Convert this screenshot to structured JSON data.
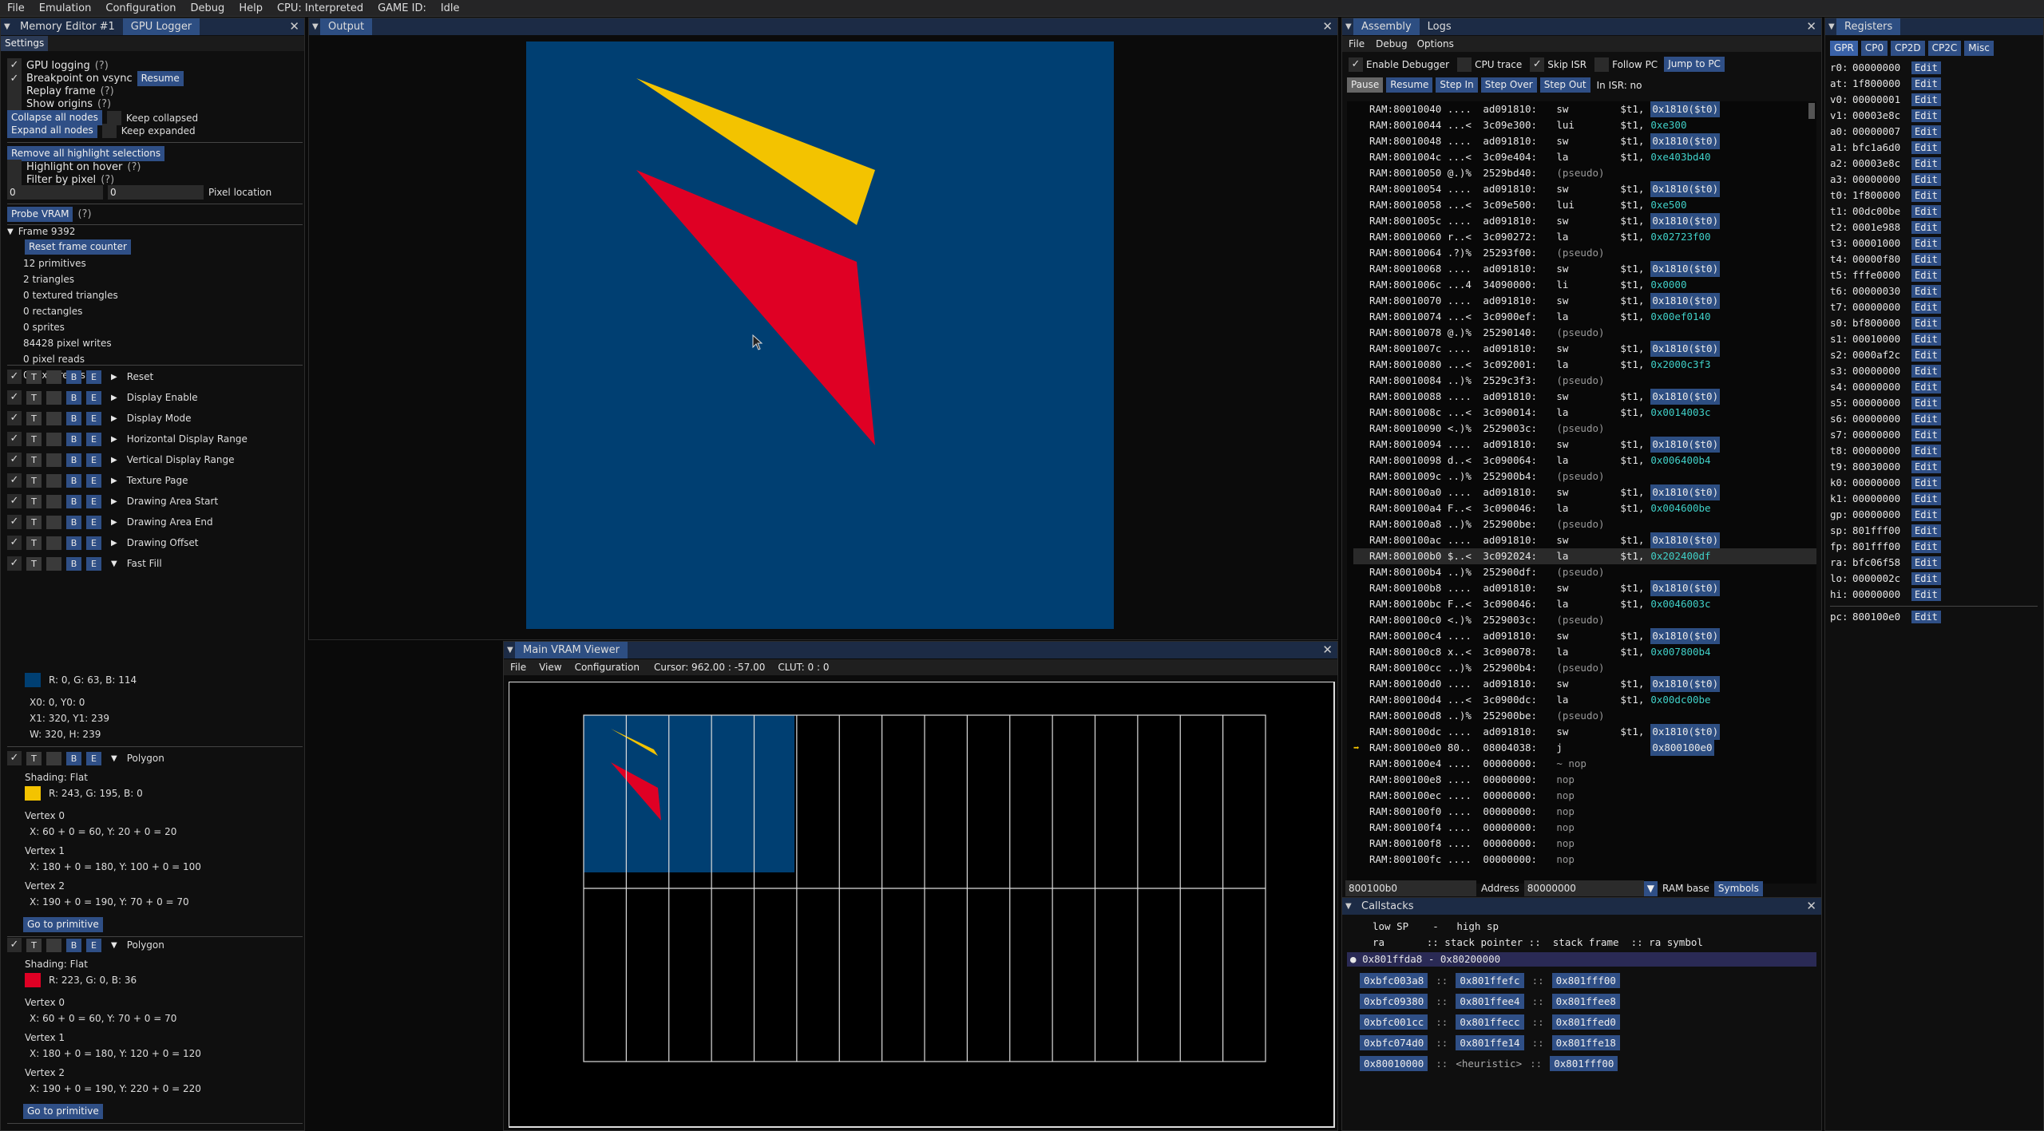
{
  "menubar": {
    "items": [
      "File",
      "Emulation",
      "Configuration",
      "Debug",
      "Help",
      "CPU: Interpreted",
      "GAME ID:",
      "Idle"
    ]
  },
  "left_panel": {
    "tabs": [
      "Memory Editor #1",
      "GPU Logger"
    ],
    "settings_tab": "Settings",
    "gpu_logging": "GPU logging",
    "hint": "(?)",
    "breakpoint_on_vsync": "Breakpoint on vsync",
    "resume": "Resume",
    "replay_frame": "Replay frame",
    "show_origins": "Show origins",
    "collapse_all": "Collapse all nodes",
    "keep_collapsed": "Keep collapsed",
    "expand_all": "Expand all nodes",
    "keep_expanded": "Keep expanded",
    "remove_highlights": "Remove all highlight selections",
    "highlight_on_hover": "Highlight on hover",
    "filter_by_pixel": "Filter by pixel",
    "pixel_x": "0",
    "pixel_y": "0",
    "pixel_location": "Pixel location",
    "probe_vram": "Probe VRAM",
    "frame": "Frame 9392",
    "reset_frame_counter": "Reset frame counter",
    "stats": [
      "12 primitives",
      "2 triangles",
      "0 textured triangles",
      "0 rectangles",
      "0 sprites",
      "84428 pixel writes",
      "0 pixel reads",
      "0 texel reads"
    ],
    "commands": [
      "Reset",
      "Display Enable",
      "Display Mode",
      "Horizontal Display Range",
      "Vertical Display Range",
      "Texture Page",
      "Drawing Area Start",
      "Drawing Area End",
      "Drawing Offset",
      "Fast Fill"
    ],
    "fastfill": {
      "color": "#003f72",
      "color_text": "R: 0, G: 63, B: 114",
      "pos": "X0: 0, Y0: 0",
      "x1y1": "X1: 320, Y1: 239",
      "wh": "W: 320, H: 239"
    },
    "polygon_label": "Polygon",
    "poly1": {
      "shading": "Shading: Flat",
      "color": "#f3c300",
      "color_text": "R: 243, G: 195, B: 0",
      "v0": "Vertex 0",
      "v0v": "X: 60 + 0 = 60, Y: 20 + 0 = 20",
      "v1": "Vertex 1",
      "v1v": "X: 180 + 0 = 180, Y: 100 + 0 = 100",
      "v2": "Vertex 2",
      "v2v": "X: 190 + 0 = 190, Y: 70 + 0 = 70"
    },
    "poly2": {
      "shading": "Shading: Flat",
      "color": "#df0024",
      "color_text": "R: 223, G: 0, B: 36",
      "v0": "Vertex 0",
      "v0v": "X: 60 + 0 = 60, Y: 70 + 0 = 70",
      "v1": "Vertex 1",
      "v1v": "X: 180 + 0 = 180, Y: 120 + 0 = 120",
      "v2": "Vertex 2",
      "v2v": "X: 190 + 0 = 190, Y: 220 + 0 = 220"
    },
    "goto": "Go to primitive",
    "tog_t": "T",
    "tog_b": "B",
    "tog_e": "E"
  },
  "output": {
    "title": "Output",
    "bg": "#003f72"
  },
  "vram": {
    "title": "Main VRAM Viewer",
    "menu": [
      "File",
      "View",
      "Configuration"
    ],
    "cursor": "Cursor: 962.00 : -57.00",
    "clut": "CLUT: 0 : 0"
  },
  "assembly": {
    "tabs": [
      "Assembly",
      "Logs"
    ],
    "menu": [
      "File",
      "Debug",
      "Options"
    ],
    "enable_debugger": "Enable Debugger",
    "cpu_trace": "CPU trace",
    "skip_isr": "Skip ISR",
    "follow_pc": "Follow PC",
    "jump_to_pc": "Jump to PC",
    "pause": "Pause",
    "resume": "Resume",
    "step_in": "Step In",
    "step_over": "Step Over",
    "step_out": "Step Out",
    "in_isr": "In ISR: no",
    "lines": [
      {
        "a": "RAM:80010040",
        "b": " ....",
        "c": "ad091810:",
        "d": "sw",
        "e": "$t1,",
        "f": "0x1810($t0)",
        "t": "hl"
      },
      {
        "a": "RAM:80010044",
        "b": " ...<",
        "c": "3c09e300:",
        "d": "lui",
        "e": "$t1,",
        "f": "0xe300",
        "t": "teal"
      },
      {
        "a": "RAM:80010048",
        "b": " ....",
        "c": "ad091810:",
        "d": "sw",
        "e": "$t1,",
        "f": "0x1810($t0)",
        "t": "hl"
      },
      {
        "a": "RAM:8001004c",
        "b": " ...<",
        "c": "3c09e404:",
        "d": "la",
        "e": "$t1,",
        "f": "0xe403bd40",
        "t": "teal"
      },
      {
        "a": "RAM:80010050",
        "b": " @.)%",
        "c": "2529bd40:",
        "d": "(pseudo)",
        "e": "",
        "f": "",
        "t": "p"
      },
      {
        "a": "RAM:80010054",
        "b": " ....",
        "c": "ad091810:",
        "d": "sw",
        "e": "$t1,",
        "f": "0x1810($t0)",
        "t": "hl"
      },
      {
        "a": "RAM:80010058",
        "b": " ...<",
        "c": "3c09e500:",
        "d": "lui",
        "e": "$t1,",
        "f": "0xe500",
        "t": "teal"
      },
      {
        "a": "RAM:8001005c",
        "b": " ....",
        "c": "ad091810:",
        "d": "sw",
        "e": "$t1,",
        "f": "0x1810($t0)",
        "t": "hl"
      },
      {
        "a": "RAM:80010060",
        "b": " r..<",
        "c": "3c090272:",
        "d": "la",
        "e": "$t1,",
        "f": "0x02723f00",
        "t": "teal"
      },
      {
        "a": "RAM:80010064",
        "b": " .?)%",
        "c": "25293f00:",
        "d": "(pseudo)",
        "e": "",
        "f": "",
        "t": "p"
      },
      {
        "a": "RAM:80010068",
        "b": " ....",
        "c": "ad091810:",
        "d": "sw",
        "e": "$t1,",
        "f": "0x1810($t0)",
        "t": "hl"
      },
      {
        "a": "RAM:8001006c",
        "b": " ...4",
        "c": "34090000:",
        "d": "li",
        "e": "$t1,",
        "f": "0x0000",
        "t": "teal"
      },
      {
        "a": "RAM:80010070",
        "b": " ....",
        "c": "ad091810:",
        "d": "sw",
        "e": "$t1,",
        "f": "0x1810($t0)",
        "t": "hl"
      },
      {
        "a": "RAM:80010074",
        "b": " ...<",
        "c": "3c0900ef:",
        "d": "la",
        "e": "$t1,",
        "f": "0x00ef0140",
        "t": "teal"
      },
      {
        "a": "RAM:80010078",
        "b": " @.)%",
        "c": "25290140:",
        "d": "(pseudo)",
        "e": "",
        "f": "",
        "t": "p"
      },
      {
        "a": "RAM:8001007c",
        "b": " ....",
        "c": "ad091810:",
        "d": "sw",
        "e": "$t1,",
        "f": "0x1810($t0)",
        "t": "hl"
      },
      {
        "a": "RAM:80010080",
        "b": " ...<",
        "c": "3c092001:",
        "d": "la",
        "e": "$t1,",
        "f": "0x2000c3f3",
        "t": "teal"
      },
      {
        "a": "RAM:80010084",
        "b": " ..)%",
        "c": "2529c3f3:",
        "d": "(pseudo)",
        "e": "",
        "f": "",
        "t": "p"
      },
      {
        "a": "RAM:80010088",
        "b": " ....",
        "c": "ad091810:",
        "d": "sw",
        "e": "$t1,",
        "f": "0x1810($t0)",
        "t": "hl"
      },
      {
        "a": "RAM:8001008c",
        "b": " ...<",
        "c": "3c090014:",
        "d": "la",
        "e": "$t1,",
        "f": "0x0014003c",
        "t": "teal"
      },
      {
        "a": "RAM:80010090",
        "b": " <.)%",
        "c": "2529003c:",
        "d": "(pseudo)",
        "e": "",
        "f": "",
        "t": "p"
      },
      {
        "a": "RAM:80010094",
        "b": " ....",
        "c": "ad091810:",
        "d": "sw",
        "e": "$t1,",
        "f": "0x1810($t0)",
        "t": "hl"
      },
      {
        "a": "RAM:80010098",
        "b": " d..<",
        "c": "3c090064:",
        "d": "la",
        "e": "$t1,",
        "f": "0x006400b4",
        "t": "teal"
      },
      {
        "a": "RAM:8001009c",
        "b": " ..)%",
        "c": "252900b4:",
        "d": "(pseudo)",
        "e": "",
        "f": "",
        "t": "p"
      },
      {
        "a": "RAM:800100a0",
        "b": " ....",
        "c": "ad091810:",
        "d": "sw",
        "e": "$t1,",
        "f": "0x1810($t0)",
        "t": "hl"
      },
      {
        "a": "RAM:800100a4",
        "b": " F..<",
        "c": "3c090046:",
        "d": "la",
        "e": "$t1,",
        "f": "0x004600be",
        "t": "teal"
      },
      {
        "a": "RAM:800100a8",
        "b": " ..)%",
        "c": "252900be:",
        "d": "(pseudo)",
        "e": "",
        "f": "",
        "t": "p"
      },
      {
        "a": "RAM:800100ac",
        "b": " ....",
        "c": "ad091810:",
        "d": "sw",
        "e": "$t1,",
        "f": "0x1810($t0)",
        "t": "hl"
      },
      {
        "a": "RAM:800100b0",
        "b": " $..<",
        "c": "3c092024:",
        "d": "la",
        "e": "$t1,",
        "f": "0x202400df",
        "t": "teal",
        "sel": true
      },
      {
        "a": "RAM:800100b4",
        "b": " ..)%",
        "c": "252900df:",
        "d": "(pseudo)",
        "e": "",
        "f": "",
        "t": "p"
      },
      {
        "a": "RAM:800100b8",
        "b": " ....",
        "c": "ad091810:",
        "d": "sw",
        "e": "$t1,",
        "f": "0x1810($t0)",
        "t": "hl"
      },
      {
        "a": "RAM:800100bc",
        "b": " F..<",
        "c": "3c090046:",
        "d": "la",
        "e": "$t1,",
        "f": "0x0046003c",
        "t": "teal"
      },
      {
        "a": "RAM:800100c0",
        "b": " <.)%",
        "c": "2529003c:",
        "d": "(pseudo)",
        "e": "",
        "f": "",
        "t": "p"
      },
      {
        "a": "RAM:800100c4",
        "b": " ....",
        "c": "ad091810:",
        "d": "sw",
        "e": "$t1,",
        "f": "0x1810($t0)",
        "t": "hl"
      },
      {
        "a": "RAM:800100c8",
        "b": " x..<",
        "c": "3c090078:",
        "d": "la",
        "e": "$t1,",
        "f": "0x007800b4",
        "t": "teal"
      },
      {
        "a": "RAM:800100cc",
        "b": " ..)%",
        "c": "252900b4:",
        "d": "(pseudo)",
        "e": "",
        "f": "",
        "t": "p"
      },
      {
        "a": "RAM:800100d0",
        "b": " ....",
        "c": "ad091810:",
        "d": "sw",
        "e": "$t1,",
        "f": "0x1810($t0)",
        "t": "hl"
      },
      {
        "a": "RAM:800100d4",
        "b": " ...<",
        "c": "3c0900dc:",
        "d": "la",
        "e": "$t1,",
        "f": "0x00dc00be",
        "t": "teal"
      },
      {
        "a": "RAM:800100d8",
        "b": " ..)%",
        "c": "252900be:",
        "d": "(pseudo)",
        "e": "",
        "f": "",
        "t": "p"
      },
      {
        "a": "RAM:800100dc",
        "b": " ....",
        "c": "ad091810:",
        "d": "sw",
        "e": "$t1,",
        "f": "0x1810($t0)",
        "t": "hl"
      },
      {
        "a": "RAM:800100e0",
        "b": " 80..",
        "c": "08004038:",
        "d": "j",
        "e": "",
        "f": "0x800100e0",
        "t": "hl",
        "pc": true
      },
      {
        "a": "RAM:800100e4",
        "b": " ....",
        "c": "00000000:",
        "d": "~ nop",
        "e": "",
        "f": "",
        "t": "p"
      },
      {
        "a": "RAM:800100e8",
        "b": " ....",
        "c": "00000000:",
        "d": "nop",
        "e": "",
        "f": "",
        "t": "p"
      },
      {
        "a": "RAM:800100ec",
        "b": " ....",
        "c": "00000000:",
        "d": "nop",
        "e": "",
        "f": "",
        "t": "p"
      },
      {
        "a": "RAM:800100f0",
        "b": " ....",
        "c": "00000000:",
        "d": "nop",
        "e": "",
        "f": "",
        "t": "p"
      },
      {
        "a": "RAM:800100f4",
        "b": " ....",
        "c": "00000000:",
        "d": "nop",
        "e": "",
        "f": "",
        "t": "p"
      },
      {
        "a": "RAM:800100f8",
        "b": " ....",
        "c": "00000000:",
        "d": "nop",
        "e": "",
        "f": "",
        "t": "p"
      },
      {
        "a": "RAM:800100fc",
        "b": " ....",
        "c": "00000000:",
        "d": "nop",
        "e": "",
        "f": "",
        "t": "p"
      }
    ],
    "addr_value": "800100b0",
    "address": "Address",
    "ram_base_value": "80000000",
    "ram_base": "RAM base",
    "symbols": "Symbols"
  },
  "callstacks": {
    "title": "Callstacks",
    "hdr1": "low SP    -   high sp",
    "hdr2": "ra       :: stack pointer ::  stack frame  :: ra symbol",
    "group": "0x801ffda8 - 0x80200000",
    "rows": [
      [
        "0xbfc003a8",
        "0x801ffefc",
        "0x801fff00"
      ],
      [
        "0xbfc09380",
        "0x801ffee4",
        "0x801ffee8"
      ],
      [
        "0xbfc001cc",
        "0x801ffecc",
        "0x801ffed0"
      ],
      [
        "0xbfc074d0",
        "0x801ffe14",
        "0x801ffe18"
      ],
      [
        "0x80010000",
        "<heuristic>",
        "0x801fff00"
      ]
    ],
    "sep": "::"
  },
  "registers": {
    "title": "Registers",
    "tabs": [
      "GPR",
      "CP0",
      "CP2D",
      "CP2C",
      "Misc"
    ],
    "edit": "Edit",
    "regs": [
      [
        "r0:",
        "00000000"
      ],
      [
        "at:",
        "1f800000"
      ],
      [
        "v0:",
        "00000001"
      ],
      [
        "v1:",
        "00003e8c"
      ],
      [
        "a0:",
        "00000007"
      ],
      [
        "a1:",
        "bfc1a6d0"
      ],
      [
        "a2:",
        "00003e8c"
      ],
      [
        "a3:",
        "00000000"
      ],
      [
        "t0:",
        "1f800000"
      ],
      [
        "t1:",
        "00dc00be"
      ],
      [
        "t2:",
        "0001e988"
      ],
      [
        "t3:",
        "00001000"
      ],
      [
        "t4:",
        "00000f80"
      ],
      [
        "t5:",
        "fffe0000"
      ],
      [
        "t6:",
        "00000030"
      ],
      [
        "t7:",
        "00000000"
      ],
      [
        "s0:",
        "bf800000"
      ],
      [
        "s1:",
        "00010000"
      ],
      [
        "s2:",
        "0000af2c"
      ],
      [
        "s3:",
        "00000000"
      ],
      [
        "s4:",
        "00000000"
      ],
      [
        "s5:",
        "00000000"
      ],
      [
        "s6:",
        "00000000"
      ],
      [
        "s7:",
        "00000000"
      ],
      [
        "t8:",
        "00000000"
      ],
      [
        "t9:",
        "80030000"
      ],
      [
        "k0:",
        "00000000"
      ],
      [
        "k1:",
        "00000000"
      ],
      [
        "gp:",
        "00000000"
      ],
      [
        "sp:",
        "801fff00"
      ],
      [
        "fp:",
        "801fff00"
      ],
      [
        "ra:",
        "bfc06f58"
      ],
      [
        "lo:",
        "0000002c"
      ],
      [
        "hi:",
        "00000000"
      ]
    ],
    "pc": [
      "pc:",
      "800100e0"
    ]
  }
}
